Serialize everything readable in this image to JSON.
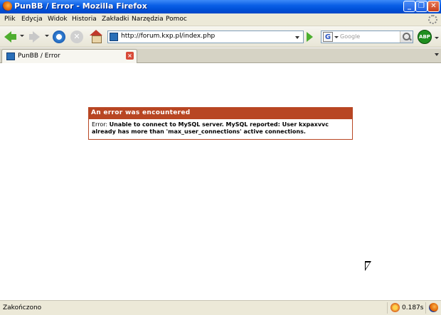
{
  "window": {
    "title": "PunBB / Error - Mozilla Firefox"
  },
  "menu": [
    "Plik",
    "Edycja",
    "Widok",
    "Historia",
    "Zakładki",
    "Narzędzia",
    "Pomoc"
  ],
  "navbar": {
    "url": "http://forum.kxp.pl/index.php",
    "search_placeholder": "Google",
    "search_engine_letter": "G",
    "abp_label": "ABP"
  },
  "tab": {
    "label": "PunBB / Error"
  },
  "error": {
    "heading": "An error was encountered",
    "prefix": "Error:",
    "message": "Unable to connect to MySQL server. MySQL reported: User kxpaxvvc already has more than 'max_user_connections' active connections."
  },
  "status": {
    "text": "Zakończono",
    "time": "0.187s"
  },
  "colors": {
    "accent": "#b84623",
    "titlebar": "#0050d8"
  }
}
